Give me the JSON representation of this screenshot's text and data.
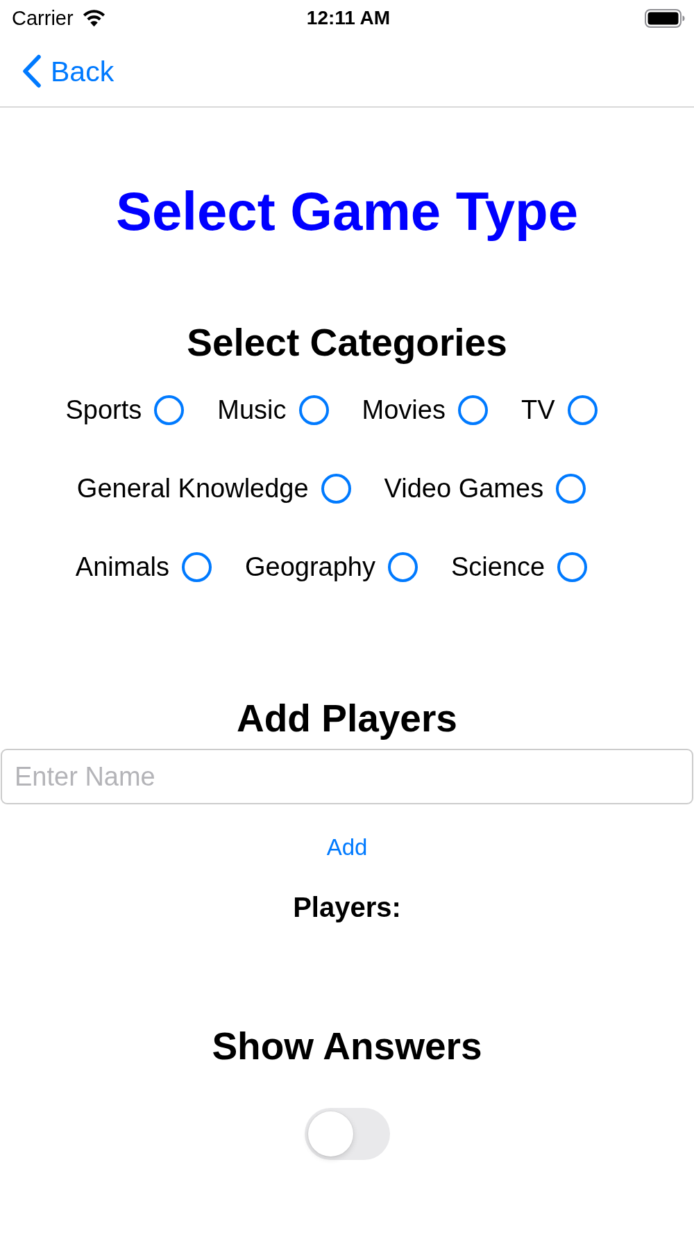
{
  "status_bar": {
    "carrier": "Carrier",
    "time": "12:11 AM"
  },
  "nav_bar": {
    "back_label": "Back"
  },
  "title": "Select Game Type",
  "categories": {
    "heading": "Select Categories",
    "rows": [
      {
        "items": [
          {
            "label": "Sports",
            "selected": false
          },
          {
            "label": "Music",
            "selected": false
          },
          {
            "label": "Movies",
            "selected": false
          },
          {
            "label": "TV",
            "selected": false
          }
        ]
      },
      {
        "items": [
          {
            "label": "General Knowledge",
            "selected": false
          },
          {
            "label": "Video Games",
            "selected": false
          }
        ]
      },
      {
        "items": [
          {
            "label": "Animals",
            "selected": false
          },
          {
            "label": "Geography",
            "selected": false
          },
          {
            "label": "Science",
            "selected": false
          }
        ]
      }
    ]
  },
  "players": {
    "heading": "Add Players",
    "name_field": {
      "placeholder": "Enter Name"
    },
    "add_button": "Add",
    "list_label": "Players:"
  },
  "show_answers": {
    "heading": "Show Answers",
    "toggle": {
      "on": false
    }
  }
}
